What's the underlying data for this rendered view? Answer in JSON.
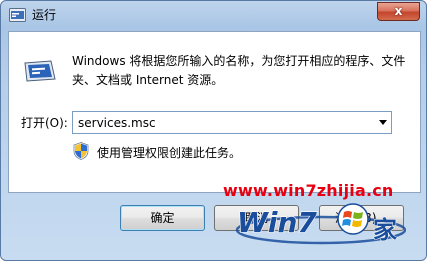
{
  "window": {
    "title": "运行",
    "close_label": "x"
  },
  "dialog": {
    "description": "Windows 将根据您所输入的名称，为您打开相应的程序、文件夹、文档或 Internet 资源。",
    "open_label": "打开(O):",
    "command_value": "services.msc",
    "admin_note": "使用管理权限创建此任务。"
  },
  "buttons": {
    "ok": "确定",
    "cancel": "取消",
    "browse": "浏览(B)..."
  },
  "watermark": {
    "url": "www.win7zhijia.cn",
    "logo_text": "Win7",
    "logo_char": "家"
  },
  "icons": {
    "title": "run-icon",
    "dialog": "run-dialog-icon",
    "admin": "uac-shield-icon",
    "combo": "chevron-down-icon"
  },
  "colors": {
    "title_bar": "#b4cfea",
    "close_button": "#c4452c",
    "watermark_red": "#e60012",
    "logo_blue": "#1a4d9c"
  }
}
